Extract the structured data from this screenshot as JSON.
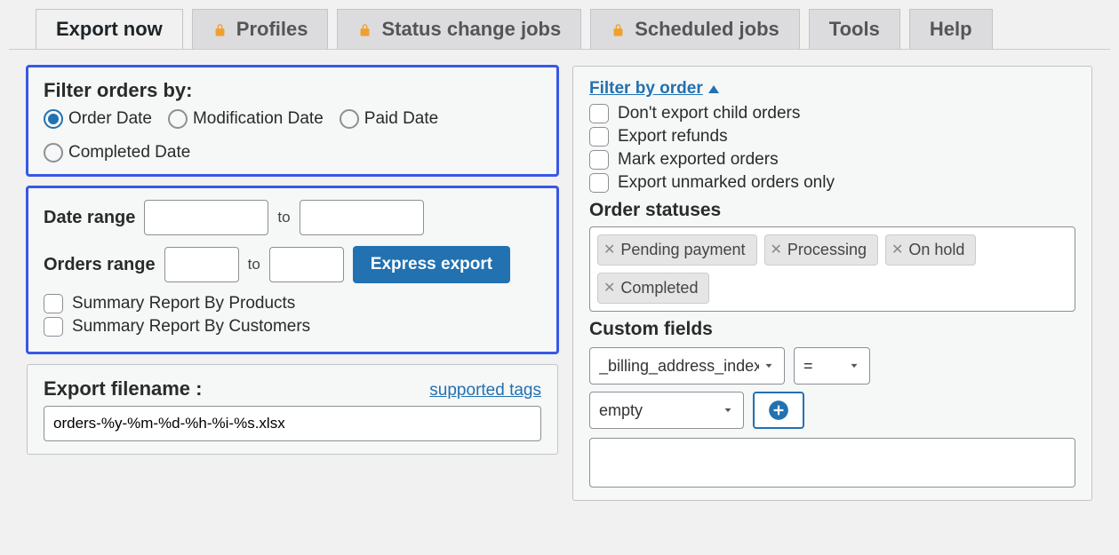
{
  "tabs": {
    "export_now": "Export now",
    "profiles": "Profiles",
    "status_change": "Status change jobs",
    "scheduled": "Scheduled jobs",
    "tools": "Tools",
    "help": "Help"
  },
  "filter_by_heading": "Filter orders by:",
  "filter_radios": {
    "order_date": "Order Date",
    "modification_date": "Modification Date",
    "paid_date": "Paid Date",
    "completed_date": "Completed Date"
  },
  "range_panel": {
    "date_range_label": "Date range",
    "date_from": "",
    "date_to": "",
    "to_word": "to",
    "orders_range_label": "Orders range",
    "orders_from": "",
    "orders_to": "",
    "express_button": "Express export",
    "summary_products": "Summary Report By Products",
    "summary_customers": "Summary Report By Customers"
  },
  "filename_panel": {
    "heading": "Export filename :",
    "supported_tags": "supported tags",
    "value": "orders-%y-%m-%d-%h-%i-%s.xlsx"
  },
  "right": {
    "filter_by_order": "Filter by order",
    "checks": {
      "no_child": "Don't export child orders",
      "export_refunds": "Export refunds",
      "mark_exported": "Mark exported orders",
      "unmarked_only": "Export unmarked orders only"
    },
    "order_statuses_heading": "Order statuses",
    "statuses": [
      "Pending payment",
      "Processing",
      "On hold",
      "Completed"
    ],
    "custom_fields_heading": "Custom fields",
    "cf_key": "_billing_address_index",
    "cf_op": "=",
    "cf_val": "empty"
  }
}
